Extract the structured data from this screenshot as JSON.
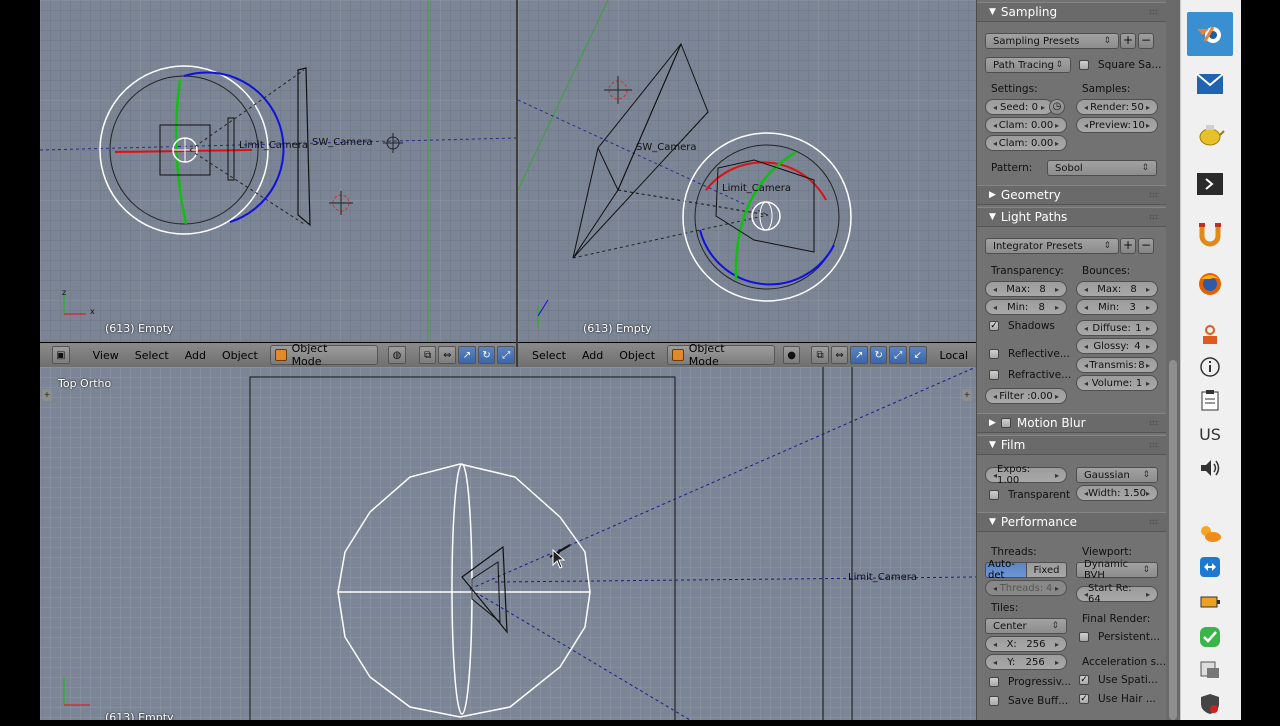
{
  "viewport_tl": {
    "status": "(613) Empty",
    "axis_y": "z",
    "axis_x": "x",
    "labels": {
      "limit_camera": "Limit_Camera",
      "sw_camera": "SW_Camera"
    }
  },
  "viewport_tr": {
    "status": "(613) Empty",
    "labels": {
      "limit_camera": "Limit_Camera",
      "sw_camera": "SW_Camera"
    }
  },
  "viewport_bottom": {
    "view_name": "Top Ortho",
    "status": "(613) Empty",
    "labels": {
      "limit_camera": "Limit_Camera"
    }
  },
  "header_left": {
    "view": "View",
    "select": "Select",
    "add": "Add",
    "object": "Object",
    "mode": "Object Mode"
  },
  "header_right": {
    "select": "Select",
    "add": "Add",
    "object": "Object",
    "mode": "Object Mode",
    "local": "Local"
  },
  "properties": {
    "sampling": {
      "title": "Sampling",
      "presets": "Sampling Presets",
      "integrator": "Path Tracing",
      "square_samples": "Square Sa...",
      "settings_label": "Settings:",
      "samples_label": "Samples:",
      "seed": "Seed: 0",
      "clam1": "Clam: 0.00",
      "clam2": "Clam: 0.00",
      "render": "Render:",
      "render_val": "50",
      "preview": "Preview:",
      "preview_val": "10",
      "pattern_label": "Pattern:",
      "pattern": "Sobol"
    },
    "geometry": {
      "title": "Geometry"
    },
    "light_paths": {
      "title": "Light Paths",
      "presets": "Integrator Presets",
      "transparency_label": "Transparency:",
      "bounces_label": "Bounces:",
      "t_max": "Max:",
      "t_max_val": "8",
      "t_min": "Min:",
      "t_min_val": "8",
      "b_max": "Max:",
      "b_max_val": "8",
      "b_min": "Min:",
      "b_min_val": "3",
      "shadows": "Shadows",
      "reflective": "Reflective...",
      "refractive": "Refractive...",
      "filter": "Filter :0.00",
      "diffuse": "Diffuse:",
      "diffuse_val": "1",
      "glossy": "Glossy:",
      "glossy_val": "4",
      "transmis": "Transmis:",
      "transmis_val": "8",
      "volume": "Volume:",
      "volume_val": "1"
    },
    "motion_blur": {
      "title": "Motion Blur"
    },
    "film": {
      "title": "Film",
      "expos": "Expos: 1.00",
      "filter_type": "Gaussian",
      "transparent": "Transparent",
      "width": "Width: 1.50"
    },
    "performance": {
      "title": "Performance",
      "threads_label": "Threads:",
      "auto": "Auto-det",
      "fixed": "Fixed",
      "threads": "Threads:",
      "threads_val": "4",
      "viewport_label": "Viewport:",
      "viewport_bvh": "Dynamic BVH",
      "start_re": "Start Re: 64",
      "tiles_label": "Tiles:",
      "tiles_order": "Center",
      "x": "X:",
      "x_val": "256",
      "y": "Y:",
      "y_val": "256",
      "final_render": "Final Render:",
      "persistent": "Persistent...",
      "accel": "Acceleration s...",
      "use_spati": "Use Spati...",
      "use_hair": "Use Hair ...",
      "progressive": "Progressiv...",
      "save_buff": "Save Buff..."
    }
  },
  "taskbar": {
    "language": "US"
  },
  "colors": {
    "viewport_bg": "#7b8595",
    "panel_bg": "#727272",
    "x_axis": "#d00000",
    "y_axis": "#00b000",
    "z_axis": "#0000d0"
  }
}
